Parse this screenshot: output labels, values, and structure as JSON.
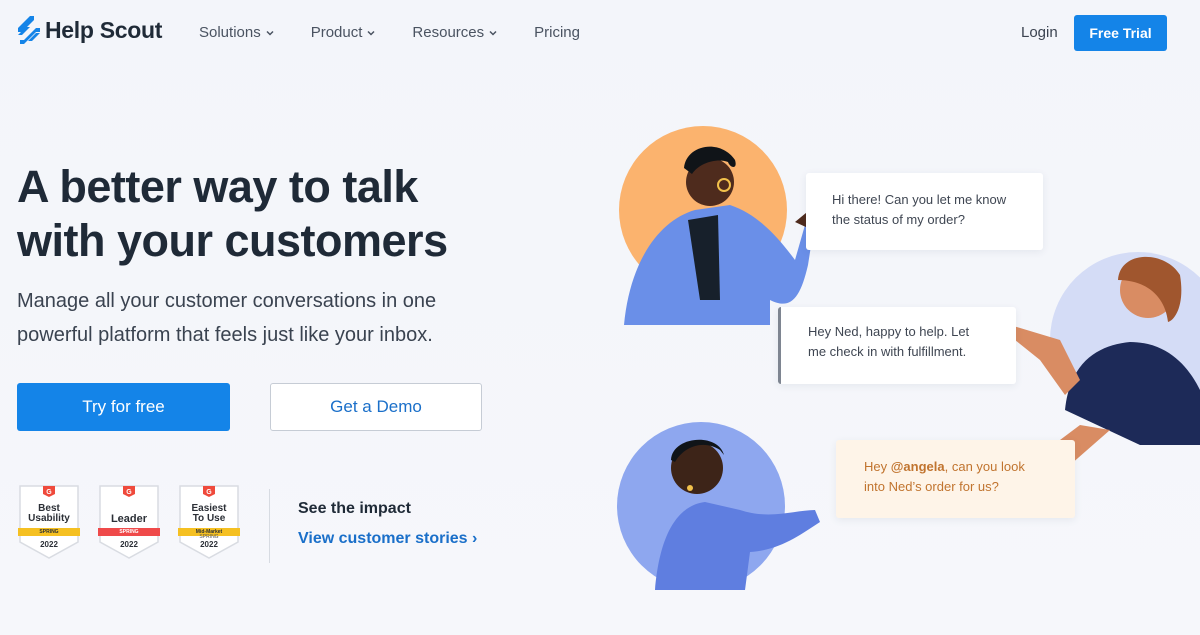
{
  "brand": {
    "name": "Help Scout",
    "accent": "#1484e8"
  },
  "nav": {
    "items": [
      {
        "label": "Solutions",
        "has_dropdown": true
      },
      {
        "label": "Product",
        "has_dropdown": true
      },
      {
        "label": "Resources",
        "has_dropdown": true
      },
      {
        "label": "Pricing",
        "has_dropdown": false
      }
    ],
    "login_label": "Login",
    "free_trial_label": "Free Trial"
  },
  "hero": {
    "headline_line1": "A better way to talk",
    "headline_line2": "with your customers",
    "subtext_line1": "Manage all your customer conversations in one",
    "subtext_line2": "powerful platform that feels just like your inbox.",
    "primary_cta": "Try for free",
    "secondary_cta": "Get a Demo"
  },
  "badges": [
    {
      "title_line1": "Best",
      "title_line2": "Usability",
      "ribbon": "SPRING",
      "ribbon_color": "#f5c022",
      "year": "2022"
    },
    {
      "title_line1": "Leader",
      "title_line2": "",
      "ribbon": "SPRING",
      "ribbon_color": "#ef4a4a",
      "year": "2022"
    },
    {
      "title_line1": "Easiest",
      "title_line2": "To Use",
      "ribbon": "Mid-Market",
      "ribbon_color": "#f5c022",
      "sub": "SPRING",
      "year": "2022"
    }
  ],
  "impact": {
    "title": "See the impact",
    "link_label": "View customer stories",
    "link_arrow": "›"
  },
  "conversation": [
    {
      "line1": "Hi there! Can you let me know",
      "line2": "the status of my order?"
    },
    {
      "line1": "Hey Ned, happy to help. Let",
      "line2": "me check in with fulfillment."
    },
    {
      "prefix": "Hey ",
      "mention": "@angela",
      "line1_rest": ", can you look",
      "line2": "into Ned’s order for us?"
    }
  ]
}
